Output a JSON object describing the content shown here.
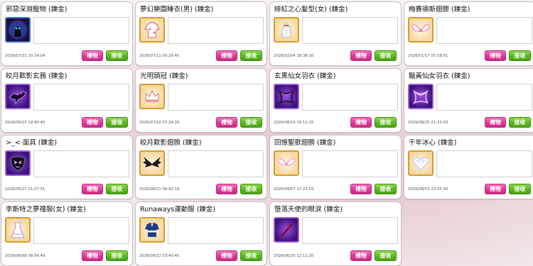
{
  "buttons": {
    "gift": "禮物",
    "accept": "接收"
  },
  "items": [
    {
      "title": "邪惡深淵寵物 (鍊金)",
      "date": "2026/07/21 10:14:04",
      "icon": "dark-pet-icon",
      "frame": "dark"
    },
    {
      "title": "夢幻樂園睡衣(男) (鍊金)",
      "date": "2026/07/11 00:29:45",
      "icon": "pajamas-icon",
      "frame": "gold"
    },
    {
      "title": "緋紅之心髮型(女) (鍊金)",
      "date": "2026/02/04 18:38:16",
      "icon": "hairstyle-icon",
      "frame": "gold"
    },
    {
      "title": "梅賽德斯翅膀 (鍊金)",
      "date": "2026/01/17 07:18:51",
      "icon": "wings-icon",
      "frame": "gold"
    },
    {
      "title": "皎月歎影玄鴉 (鍊金)",
      "date": "2026/09/15 19:40:40",
      "icon": "raven-icon",
      "frame": "purple"
    },
    {
      "title": "光明頭冠 (鍊金)",
      "date": "2026/07/10 07:24:16",
      "icon": "crown-icon",
      "frame": "gold"
    },
    {
      "title": "玄黑仙女羽衣 (鍊金)",
      "date": "2026/08/10 19:12:15",
      "icon": "dark-robe-icon",
      "frame": "purple"
    },
    {
      "title": "豔黃仙女羽衣 (鍊金)",
      "date": "2026/08/25 21:33:03",
      "icon": "yellow-robe-icon",
      "frame": "purple"
    },
    {
      "title": ">_< 面具 (鍊金)",
      "date": "2026/05/27 21:07:51",
      "icon": "mask-icon",
      "frame": "purple"
    },
    {
      "title": "皎月歎影翅膀 (鍊金)",
      "date": "2026/08/21 06:42:19",
      "icon": "dark-wings-icon",
      "frame": "gold"
    },
    {
      "title": "回憶聖歌翅膀 (鍊金)",
      "date": "2026/09/07 17:23:03",
      "icon": "angel-wings-icon",
      "frame": "gold"
    },
    {
      "title": "千年冰心 (鍊金)",
      "date": "2026/08/15 22:55:56",
      "icon": "ice-heart-icon",
      "frame": "gold"
    },
    {
      "title": "李斯特之夢禮服(女) (鍊金)",
      "date": "2026/06/08 08:54:49",
      "icon": "dress-icon",
      "frame": "gold"
    },
    {
      "title": "Runaways運動服 (鍊金)",
      "date": "2026/09/22 03:40:45",
      "icon": "sportswear-icon",
      "frame": "gold"
    },
    {
      "title": "墮落天使的眼淚 (鍊金)",
      "date": "2026/06/25 12:11:20",
      "icon": "fallen-angel-tear-icon",
      "frame": "purple"
    }
  ]
}
